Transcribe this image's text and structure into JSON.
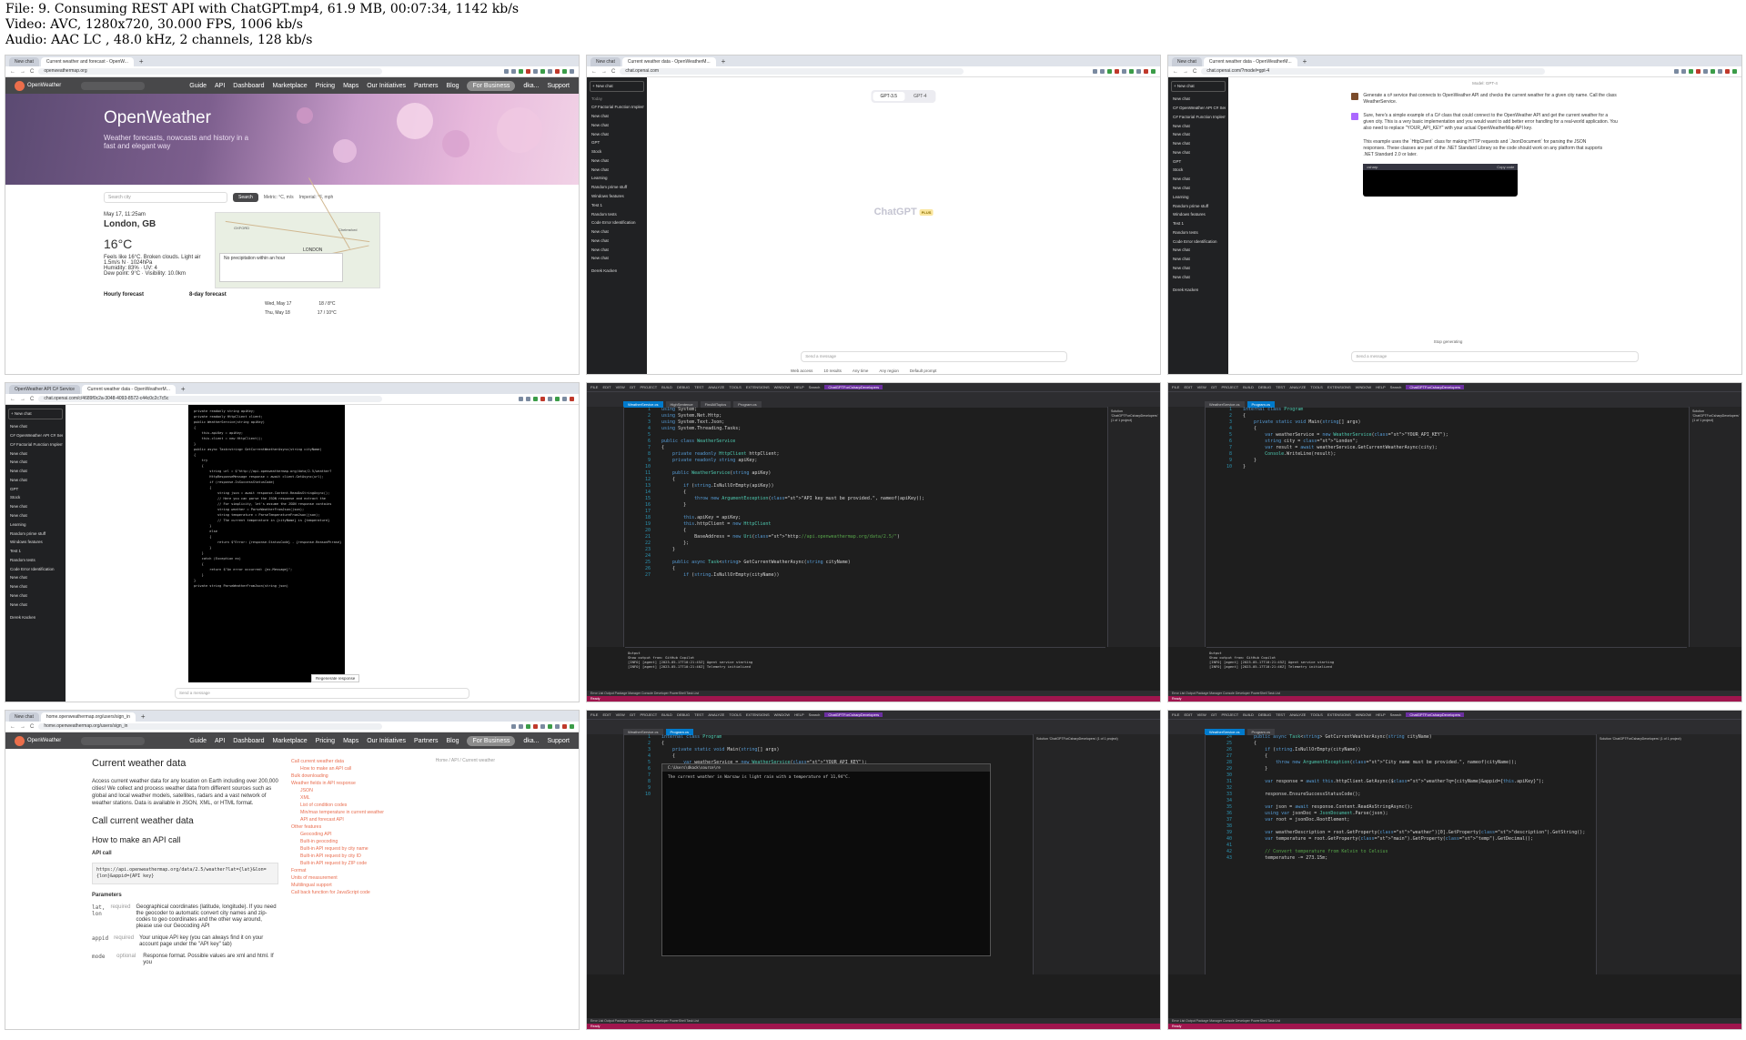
{
  "file_info": {
    "line1": "File: 9. Consuming REST API with ChatGPT.mp4, 61.9 MB, 00:07:34, 1142 kb/s",
    "line2": "Video: AVC, 1280x720, 30.000 FPS, 1006 kb/s",
    "line3": "Audio: AAC LC , 48.0 kHz, 2 channels, 128 kb/s"
  },
  "browser": {
    "tab_new_chat": "New chat",
    "tab_ow": "Current weather and forecast - OpenW...",
    "tab_ow_data": "Current weather data - OpenWeatherM...",
    "tab_ow_csharp": "OpenWeather API C# Service",
    "tab_plus": "+",
    "url_ow": "openweathermap.org",
    "url_chat": "chat.openai.com",
    "url_chat_model": "chat.openai.com/?model=gpt-4",
    "url_chat_c": "chat.openai.com/c/4689f0c2a-3048-4093-8572-c44c0c2c7c5c",
    "url_ow_api": "home.openweathermap.org/users/sign_in",
    "nav_back": "←",
    "nav_fwd": "→",
    "nav_reload": "C"
  },
  "openweather": {
    "logo": "OpenWeather",
    "nav": [
      "Guide",
      "API",
      "Dashboard",
      "Marketplace",
      "Pricing",
      "Maps",
      "Our Initiatives",
      "Partners",
      "Blog"
    ],
    "business": "For Business",
    "user": "dka...",
    "support": "Support",
    "hero_title": "OpenWeather",
    "hero_sub": "Weather forecasts, nowcasts and history in a fast and elegant way",
    "search_placeholder": "Search city",
    "search_btn": "Search",
    "units": "Metric: °C, m/s",
    "units2": "Imperial: °F, mph",
    "date": "May 17, 11:25am",
    "city": "London, GB",
    "temp": "16°C",
    "desc": "Feels like 16°C. Broken clouds. Light air",
    "wind": "1.5m/s N",
    "pressure": "1024hPa",
    "humidity": "Humidity: 83%",
    "uv": "UV: 4",
    "dew": "Dew point: 9°C",
    "visibility": "Visibility: 10.0km",
    "precip": "No precipitation within an hour",
    "map_city": "LONDON",
    "map_oxford": "OXFORD",
    "map_chelmsford": "Chelmsford",
    "hourly": "Hourly forecast",
    "eight_day": "8-day forecast",
    "day1": "Wed, May 17",
    "day1_t": "18 / 8°C",
    "day2": "Thu, May 18",
    "day2_t": "17 / 10°C"
  },
  "chat": {
    "new_chat": "+ New chat",
    "today": "Today",
    "yesterday": "Yesterday",
    "items": [
      "C# Factorial Function Implem",
      "New chat",
      "New chat",
      "New chat",
      "GPT",
      "Stock",
      "New chat",
      "New chat",
      "Learning",
      "Random prime stuff",
      "Windows features",
      "Test 1",
      "Random tests",
      "Code Error Identification",
      "New chat",
      "New chat",
      "New chat",
      "New chat"
    ],
    "items_t3": [
      "New chat",
      "C# OpenWeather API C# Serv",
      "C# Factorial Function Implem",
      "New chat",
      "New chat",
      "New chat",
      "New chat",
      "GPT",
      "Stock",
      "New chat",
      "New chat",
      "Learning",
      "Random prime stuff",
      "Windows features",
      "Test 1",
      "Random tests",
      "Code Error Identification",
      "New chat",
      "New chat",
      "New chat",
      "New chat"
    ],
    "user": "Derek Kacken",
    "gpt35": "GPT-3.5",
    "gpt4": "GPT-4",
    "brand": "ChatGPT",
    "plus": "PLUS",
    "web_access": "Web access",
    "results": "10 results",
    "any_time": "Any time",
    "any_region": "Any region",
    "default_prompt": "Default prompt",
    "send_placeholder": "Send a message",
    "model_label": "Model: GPT-4",
    "user_msg": "Generate a c# service that connects to OpenWeather API and checks the current weather for a given city name. Call the class WeatherService.",
    "bot_msg": "Sure, here's a simple example of a C# class that could connect to the OpenWeather API and get the current weather for a given city. This is a very basic implementation and you would want to add better error handling for a real-world application. You also need to replace \"YOUR_API_KEY\" with your actual OpenWeatherMap API key.",
    "bot_msg2": "This example uses the `HttpClient` class for making HTTP requests and `JsonDocument` for parsing the JSON responses. These classes are part of the .NET Standard Library so the code should work on any platform that supports .NET Standard 2.0 or later.",
    "csharp": "csharp",
    "copy_code": "Copy code",
    "stop": "Stop generating",
    "regen": "Regenerate response",
    "footer": "ChatGPT may produce inaccurate information about people, places, or facts. ChatGPT May 12 Version"
  },
  "vs": {
    "menu": [
      "FILE",
      "EDIT",
      "VIEW",
      "GIT",
      "PROJECT",
      "BUILD",
      "DEBUG",
      "TEST",
      "ANALYZE",
      "TOOLS",
      "EXTENSIONS",
      "WINDOW",
      "HELP",
      "Search"
    ],
    "project": "ChatGPTForCsharpDevelopers",
    "tab_ws": "WeatherService.cs",
    "tab_hs": "HighSentence",
    "tab_ft": "FindAllTopics",
    "tab_pg": "Program.cs",
    "live_share": "Live Share",
    "solution": "Solution 'ChatGPTForCsharpDevelopers' (1 of 1 project)",
    "output": "Output",
    "show_output": "Show output from: GitHub Copilot",
    "out1": "[INFO] [agent] [2023-05-17T10:21:45Z] Agent service starting",
    "out2": "[INFO] [agent] [2023-05-17T10:21:46Z] Telemetry initialized",
    "bottom_tabs": "Error List   Output   Package Manager Console   Developer PowerShell   Task List",
    "status": "Ready",
    "status_right": "Add to Source Control  ·  Select Repository",
    "console_title": "C:\\Users\\dkack\\source\\re",
    "console_out": "The current weather in Warsaw is light rain with a temperature of 11,94°C."
  },
  "code": {
    "ws": [
      "using System;",
      "using System.Net.Http;",
      "using System.Text.Json;",
      "using System.Threading.Tasks;",
      "",
      "public class WeatherService",
      "{",
      "    private readonly HttpClient httpClient;",
      "    private readonly string apiKey;",
      "",
      "    public WeatherService(string apiKey)",
      "    {",
      "        if (string.IsNullOrEmpty(apiKey))",
      "        {",
      "            throw new ArgumentException(\"API key must be provided.\", nameof(apiKey));",
      "        }",
      "",
      "        this.apiKey = apiKey;",
      "        this.httpClient = new HttpClient",
      "        {",
      "            BaseAddress = new Uri(\"http://api.openweathermap.org/data/2.5/\")",
      "        };",
      "    }",
      "",
      "    public async Task<string> GetCurrentWeatherAsync(string cityName)",
      "    {",
      "        if (string.IsNullOrEmpty(cityName))"
    ],
    "pg": [
      "internal class Program",
      "{",
      "    private static void Main(string[] args)",
      "    {",
      "        var weatherService = new WeatherService(\"YOUR_API_KEY\");",
      "        string city = \"London\";",
      "        var result = await weatherService.GetCurrentWeatherAsync(city);",
      "        Console.WriteLine(result);",
      "    }",
      "}"
    ],
    "t9": [
      "    public async Task<string> GetCurrentWeatherAsync(string cityName)",
      "    {",
      "        if (string.IsNullOrEmpty(cityName))",
      "        {",
      "            throw new ArgumentException(\"City name must be provided.\", nameof(cityName));",
      "        }",
      "",
      "        var response = await this.httpClient.GetAsync($\"weather?q={cityName}&appid={this.apiKey}\");",
      "",
      "        response.EnsureSuccessStatusCode();",
      "",
      "        var json = await response.Content.ReadAsStringAsync();",
      "        using var jsonDoc = JsonDocument.Parse(json);",
      "        var root = jsonDoc.RootElement;",
      "",
      "        var weatherDescription = root.GetProperty(\"weather\")[0].GetProperty(\"description\").GetString();",
      "        var temperature = root.GetProperty(\"main\").GetProperty(\"temp\").GetDecimal();",
      "",
      "        // Convert temperature from Kelvin to Celsius",
      "        temperature -= 273.15m;"
    ],
    "chat_code": [
      "private readonly string apiKey;",
      "private readonly HttpClient client;",
      "",
      "public WeatherService(string apiKey)",
      "{",
      "    this.apiKey = apiKey;",
      "    this.client = new HttpClient();",
      "}",
      "",
      "public async Task<string> GetCurrentWeatherAsync(string cityName)",
      "{",
      "    try",
      "    {",
      "        string url = $\"http://api.openweathermap.org/data/2.5/weather?",
      "        HttpResponseMessage response = await client.GetAsync(url);",
      "",
      "        if (response.IsSuccessStatusCode)",
      "        {",
      "            string json = await response.Content.ReadAsStringAsync();",
      "            // Here you can parse the JSON response and extract the",
      "            // For simplicity, let's assume the JSON response contains",
      "            string weather = ParseWeatherFromJson(json);",
      "            string temperature = ParseTemperatureFromJson(json);",
      "            // The current temperature in {cityName} is {temperature}",
      "        }",
      "        else",
      "        {",
      "            return $\"Error: {response.StatusCode} - {response.ReasonPhrase}",
      "        }",
      "    }",
      "    catch (Exception ex)",
      "    {",
      "        return $\"An error occurred: {ex.Message}\";",
      "    }",
      "}",
      "",
      "private string ParseWeatherFromJson(string json)"
    ]
  },
  "docs": {
    "breadcrumb": "Home  /  API  /  Current weather",
    "title": "Current weather data",
    "intro": "Access current weather data for any location on Earth including over 200,000 cities! We collect and process weather data from different sources such as global and local weather models, satellites, radars and a vast network of weather stations. Data is available in JSON, XML, or HTML format.",
    "call_title": "Call current weather data",
    "how_title": "How to make an API call",
    "api_call": "API call",
    "api_url": "https://api.openweathermap.org/data/2.5/weather?lat={lat}&lon={lon}&appid={API key}",
    "params": "Parameters",
    "p1_name": "lat, lon",
    "p1_req": "required",
    "p1_desc": "Geographical coordinates (latitude, longitude). If you need the geocoder to automatic convert city names and zip-codes to geo coordinates and the other way around, please use our Geocoding API",
    "p2_name": "appid",
    "p2_req": "required",
    "p2_desc": "Your unique API key (you can always find it on your account page under the \"API key\" tab)",
    "p3_name": "mode",
    "p3_req": "optional",
    "p3_desc": "Response format. Possible values are xml and html. If you",
    "toc": [
      "Call current weather data",
      "How to make an API call",
      "Bulk downloading",
      "Weather fields in API response",
      "JSON",
      "XML",
      "List of condition codes",
      "Min/max temperature in current weather",
      "API and forecast API",
      "Other features",
      "Geocoding API",
      "Built-in geocoding",
      "Built-in API request by city name",
      "Built-in API request by city ID",
      "Built-in API request by ZIP code",
      "Format",
      "Units of measurement",
      "Multilingual support",
      "Call back function for JavaScript code"
    ]
  }
}
